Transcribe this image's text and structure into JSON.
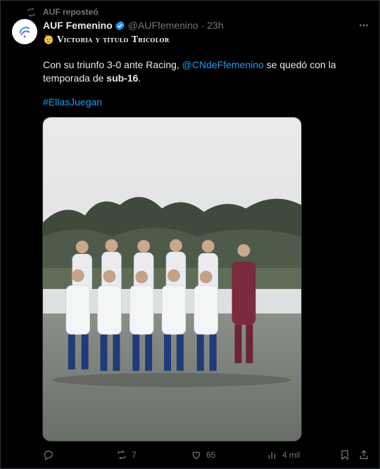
{
  "repost": {
    "label": "AUF reposteó",
    "icon": "repost-icon"
  },
  "author": {
    "name": "AUF Femenino",
    "handle": "@AUFfemenino",
    "separator": "·",
    "time": "23h",
    "verified_color": "#1d9bf0",
    "avatar_icon": "auf-femenino-logo"
  },
  "subline": {
    "emoji": "party-face-emoji",
    "text": "Victoria y título Tricolor"
  },
  "tweet": {
    "text_before": "Con su triunfo 3-0 ante Racing, ",
    "mention": "@CNdeFfemenino",
    "text_middle": " se quedó con la temporada de ",
    "bold": "sub-16",
    "text_after": ".",
    "hashtag": "#EllasJuegan"
  },
  "media": {
    "description_icon": "team-photo"
  },
  "actions": {
    "reply_count": "",
    "retweet_count": "7",
    "like_count": "65",
    "views_count": "4 mil"
  },
  "colors": {
    "accent": "#1d9bf0",
    "muted": "#71767b",
    "text": "#e7e9ea",
    "background": "#000000"
  }
}
